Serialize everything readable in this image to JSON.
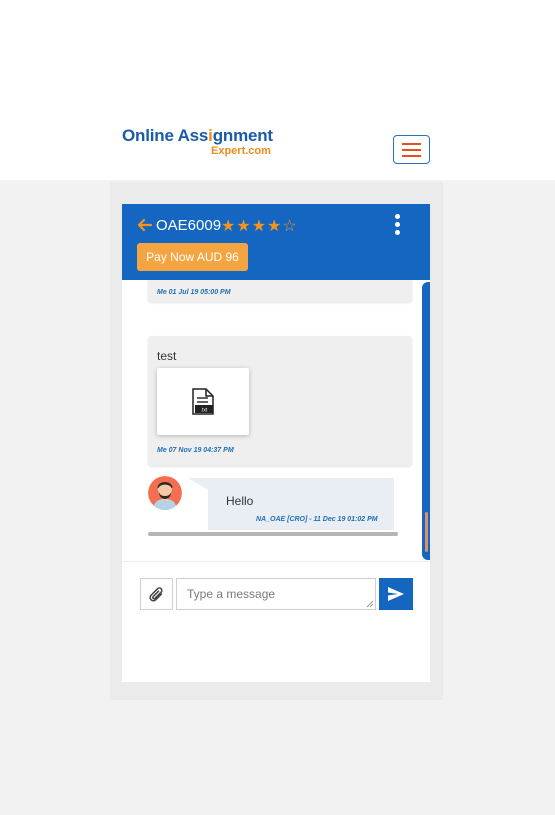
{
  "brand": {
    "name_part1": "Online Ass",
    "name_pencil": "i",
    "name_part2": "gnment",
    "name_sub": "Expert.com",
    "primary_color": "#1566c0",
    "accent_color": "#f08a1a"
  },
  "nav": {
    "menu_icon": "hamburger-icon"
  },
  "chat": {
    "order_id": "OAE6009",
    "rating_stars": "★★★★☆",
    "rating": 4,
    "rating_max": 5,
    "pay_button": "Pay Now AUD 96",
    "messages": [
      {
        "sender": "me",
        "meta": "Me 01 Jul 19 05:00 PM"
      },
      {
        "sender": "me",
        "text": "test",
        "attachment_icon": "document-icon",
        "attachment_label": ".txt",
        "meta": "Me 07 Nov 19 04:37 PM"
      },
      {
        "sender": "other",
        "text": "Hello",
        "meta": "NA_OAE [CRO] - 11 Dec 19 01:02 PM"
      }
    ],
    "composer": {
      "placeholder": "Type a message",
      "value": ""
    }
  }
}
